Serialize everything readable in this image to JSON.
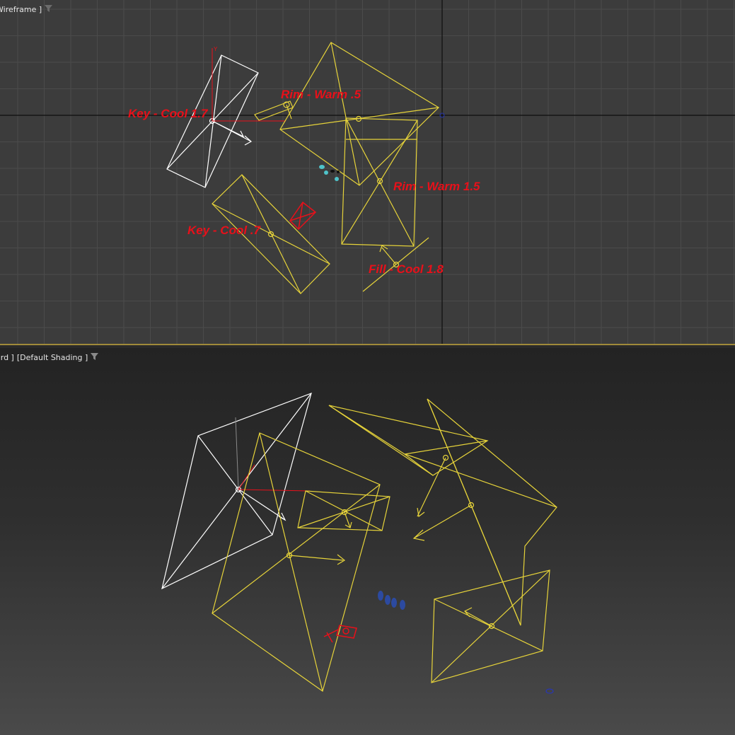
{
  "viewports": {
    "top": {
      "label_mode": "Wireframe ]"
    },
    "perspective": {
      "label_view": "ard ]",
      "label_shading": "[Default Shading ]"
    }
  },
  "light_labels": [
    {
      "id": "key-cool-1-7",
      "text": "Key - Cool 1.7"
    },
    {
      "id": "rim-warm-05",
      "text": "Rim - Warm .5"
    },
    {
      "id": "rim-warm-1-5",
      "text": "Rim - Warm 1.5"
    },
    {
      "id": "key-cool-07",
      "text": "Key - Cool .7"
    },
    {
      "id": "fill-cool-1-8",
      "text": "Fill - Cool 1.8"
    }
  ],
  "colors": {
    "grid": "#4b4b4b",
    "axis": "#101010",
    "selected_light": "#ffffff",
    "light": "#e6d33a",
    "label": "#e8101a",
    "camera": "#e8101a",
    "figures": "#4fc3c9"
  },
  "icons": {
    "filter": "funnel-icon"
  }
}
